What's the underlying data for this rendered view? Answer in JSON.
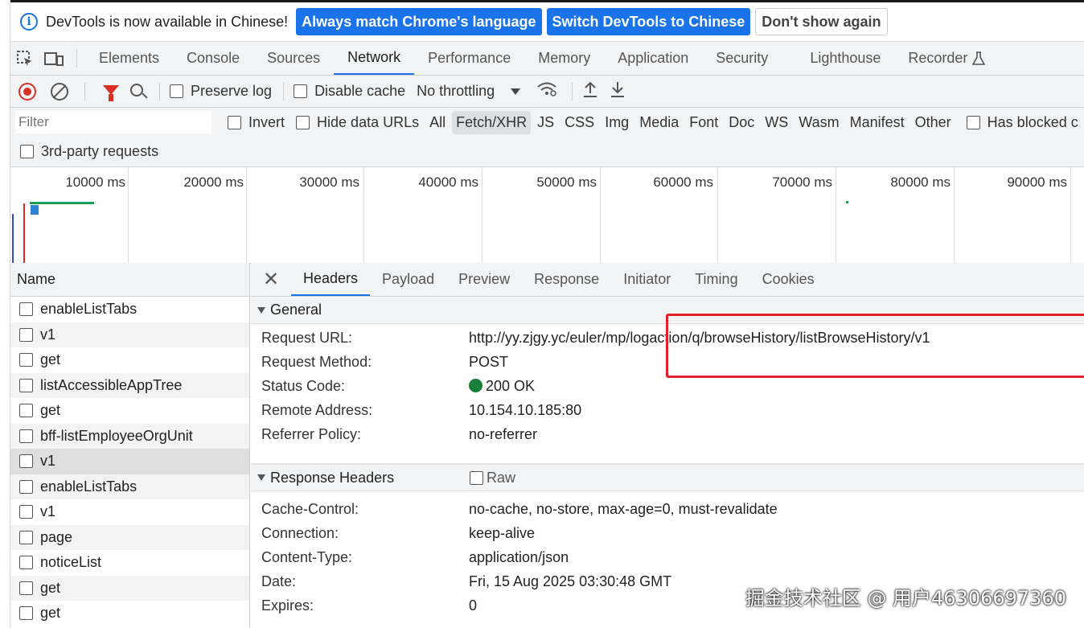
{
  "infobar": {
    "message": "DevTools is now available in Chinese!",
    "btn_match": "Always match Chrome's language",
    "btn_switch": "Switch DevTools to Chinese",
    "btn_dismiss": "Don't show again"
  },
  "tabs": [
    "Elements",
    "Console",
    "Sources",
    "Network",
    "Performance",
    "Memory",
    "Application",
    "Security",
    "Lighthouse",
    "Recorder"
  ],
  "active_tab": "Network",
  "toolbar": {
    "preserve_log": "Preserve log",
    "disable_cache": "Disable cache",
    "throttling": "No throttling"
  },
  "filter": {
    "placeholder": "Filter",
    "invert": "Invert",
    "hide_data_urls": "Hide data URLs",
    "types": [
      "All",
      "Fetch/XHR",
      "JS",
      "CSS",
      "Img",
      "Media",
      "Font",
      "Doc",
      "WS",
      "Wasm",
      "Manifest",
      "Other"
    ],
    "active_type": "Fetch/XHR",
    "has_blocked": "Has blocked c",
    "third_party": "3rd-party requests"
  },
  "overview": {
    "ticks": [
      "10000 ms",
      "20000 ms",
      "30000 ms",
      "40000 ms",
      "50000 ms",
      "60000 ms",
      "70000 ms",
      "80000 ms",
      "90000 ms"
    ]
  },
  "requests": {
    "header": "Name",
    "items": [
      "enableListTabs",
      "v1",
      "get",
      "listAccessibleAppTree",
      "get",
      "bff-listEmployeeOrgUnit",
      "v1",
      "enableListTabs",
      "v1",
      "page",
      "noticeList",
      "get",
      "get"
    ],
    "selected_index": 6
  },
  "detail": {
    "tabs": [
      "Headers",
      "Payload",
      "Preview",
      "Response",
      "Initiator",
      "Timing",
      "Cookies"
    ],
    "active_tab": "Headers",
    "general": {
      "title": "General",
      "rows": [
        {
          "k": "Request URL:",
          "v": "http://yy.zjgy.yc/euler/mp/logaction/q/browseHistory/listBrowseHistory/v1"
        },
        {
          "k": "Request Method:",
          "v": "POST"
        },
        {
          "k": "Status Code:",
          "v": "200 OK"
        },
        {
          "k": "Remote Address:",
          "v": "10.154.10.185:80"
        },
        {
          "k": "Referrer Policy:",
          "v": "no-referrer"
        }
      ]
    },
    "response_headers": {
      "title": "Response Headers",
      "raw_label": "Raw",
      "rows": [
        {
          "k": "Cache-Control:",
          "v": "no-cache, no-store, max-age=0, must-revalidate"
        },
        {
          "k": "Connection:",
          "v": "keep-alive"
        },
        {
          "k": "Content-Type:",
          "v": "application/json"
        },
        {
          "k": "Date:",
          "v": "Fri, 15 Aug 2025 03:30:48 GMT"
        },
        {
          "k": "Expires:",
          "v": "0"
        }
      ]
    }
  },
  "watermark": "掘金技术社区 @ 用户46306697360",
  "colors": {
    "accent": "#1a73e8",
    "record": "#d93025",
    "status_ok": "#188038",
    "highlight": "#e0202a"
  }
}
